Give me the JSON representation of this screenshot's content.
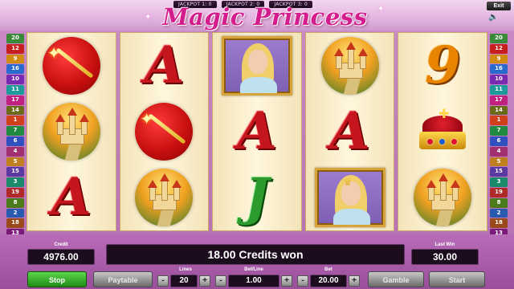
{
  "header": {
    "title": "Magic Princess",
    "jackpots": [
      "JACKPOT 1: 0",
      "JACKPOT 2: 0",
      "JACKPOT 3: 0"
    ],
    "exit_label": "Exit",
    "sound_icon": "speaker-icon"
  },
  "line_numbers": {
    "left": [
      "20",
      "12",
      "9",
      "16",
      "10",
      "11",
      "17",
      "14",
      "1",
      "7",
      "6",
      "4",
      "5",
      "15",
      "3",
      "19",
      "8",
      "2",
      "18",
      "13"
    ],
    "right": [
      "20",
      "12",
      "9",
      "16",
      "10",
      "11",
      "17",
      "14",
      "1",
      "7",
      "6",
      "4",
      "5",
      "15",
      "3",
      "19",
      "8",
      "2",
      "18",
      "13"
    ],
    "colors": [
      "#3a8a3a",
      "#c71e1e",
      "#d08a10",
      "#2a6acf",
      "#7a2ab0",
      "#1f9a9a",
      "#c02080",
      "#6a6a1a",
      "#d0401a",
      "#208a40",
      "#3050c0",
      "#a03070",
      "#c08020",
      "#5a3aa0",
      "#1a8a6a",
      "#b02a2a",
      "#4a7a1a",
      "#2a5ab0",
      "#9a4a1a",
      "#7a1a7a"
    ]
  },
  "reels": [
    [
      "wand-circle",
      "castle-circle",
      "letter-A"
    ],
    [
      "letter-A",
      "wand-circle",
      "castle-circle"
    ],
    [
      "princess-portrait",
      "letter-A",
      "letter-J"
    ],
    [
      "castle-circle",
      "letter-A",
      "princess-tiara-portrait"
    ],
    [
      "letter-9",
      "crown",
      "castle-circle"
    ]
  ],
  "panel": {
    "credit_label": "Credit",
    "credit_value": "4976.00",
    "win_message": "18.00 Credits won",
    "last_win_label": "Last Win",
    "last_win_value": "30.00",
    "stop_label": "Stop",
    "paytable_label": "Paytable",
    "lines_label": "Lines",
    "lines_value": "20",
    "bet_line_label": "Bet/Line",
    "bet_line_value": "1.00",
    "bet_label": "Bet",
    "bet_value": "20.00",
    "gamble_label": "Gamble",
    "start_label": "Start",
    "minus": "-",
    "plus": "+"
  },
  "colors": {
    "title": "#d41d8d",
    "accent_green": "#1f8a18",
    "panel_bg": "#9a4f9b"
  }
}
